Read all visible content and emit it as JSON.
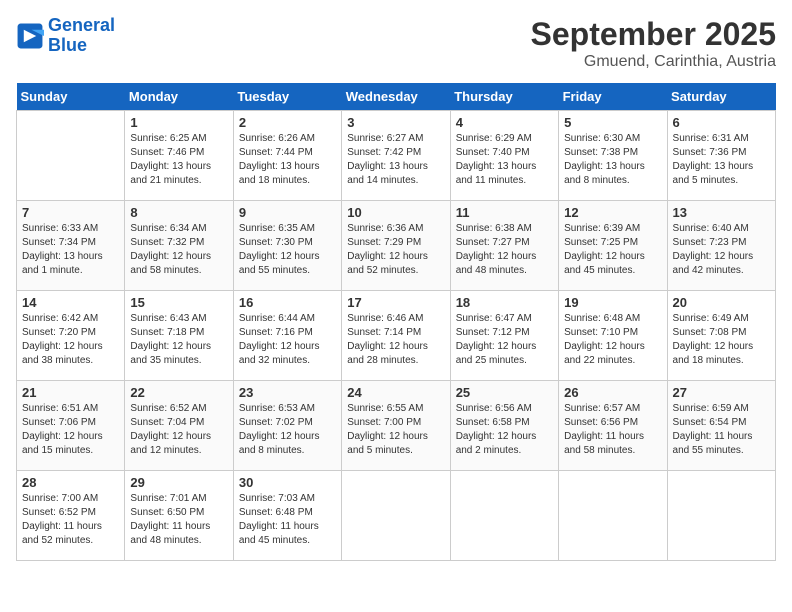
{
  "header": {
    "logo_line1": "General",
    "logo_line2": "Blue",
    "title": "September 2025",
    "subtitle": "Gmuend, Carinthia, Austria"
  },
  "calendar": {
    "days_of_week": [
      "Sunday",
      "Monday",
      "Tuesday",
      "Wednesday",
      "Thursday",
      "Friday",
      "Saturday"
    ],
    "weeks": [
      [
        {
          "date": "",
          "info": ""
        },
        {
          "date": "1",
          "info": "Sunrise: 6:25 AM\nSunset: 7:46 PM\nDaylight: 13 hours\nand 21 minutes."
        },
        {
          "date": "2",
          "info": "Sunrise: 6:26 AM\nSunset: 7:44 PM\nDaylight: 13 hours\nand 18 minutes."
        },
        {
          "date": "3",
          "info": "Sunrise: 6:27 AM\nSunset: 7:42 PM\nDaylight: 13 hours\nand 14 minutes."
        },
        {
          "date": "4",
          "info": "Sunrise: 6:29 AM\nSunset: 7:40 PM\nDaylight: 13 hours\nand 11 minutes."
        },
        {
          "date": "5",
          "info": "Sunrise: 6:30 AM\nSunset: 7:38 PM\nDaylight: 13 hours\nand 8 minutes."
        },
        {
          "date": "6",
          "info": "Sunrise: 6:31 AM\nSunset: 7:36 PM\nDaylight: 13 hours\nand 5 minutes."
        }
      ],
      [
        {
          "date": "7",
          "info": "Sunrise: 6:33 AM\nSunset: 7:34 PM\nDaylight: 13 hours\nand 1 minute."
        },
        {
          "date": "8",
          "info": "Sunrise: 6:34 AM\nSunset: 7:32 PM\nDaylight: 12 hours\nand 58 minutes."
        },
        {
          "date": "9",
          "info": "Sunrise: 6:35 AM\nSunset: 7:30 PM\nDaylight: 12 hours\nand 55 minutes."
        },
        {
          "date": "10",
          "info": "Sunrise: 6:36 AM\nSunset: 7:29 PM\nDaylight: 12 hours\nand 52 minutes."
        },
        {
          "date": "11",
          "info": "Sunrise: 6:38 AM\nSunset: 7:27 PM\nDaylight: 12 hours\nand 48 minutes."
        },
        {
          "date": "12",
          "info": "Sunrise: 6:39 AM\nSunset: 7:25 PM\nDaylight: 12 hours\nand 45 minutes."
        },
        {
          "date": "13",
          "info": "Sunrise: 6:40 AM\nSunset: 7:23 PM\nDaylight: 12 hours\nand 42 minutes."
        }
      ],
      [
        {
          "date": "14",
          "info": "Sunrise: 6:42 AM\nSunset: 7:20 PM\nDaylight: 12 hours\nand 38 minutes."
        },
        {
          "date": "15",
          "info": "Sunrise: 6:43 AM\nSunset: 7:18 PM\nDaylight: 12 hours\nand 35 minutes."
        },
        {
          "date": "16",
          "info": "Sunrise: 6:44 AM\nSunset: 7:16 PM\nDaylight: 12 hours\nand 32 minutes."
        },
        {
          "date": "17",
          "info": "Sunrise: 6:46 AM\nSunset: 7:14 PM\nDaylight: 12 hours\nand 28 minutes."
        },
        {
          "date": "18",
          "info": "Sunrise: 6:47 AM\nSunset: 7:12 PM\nDaylight: 12 hours\nand 25 minutes."
        },
        {
          "date": "19",
          "info": "Sunrise: 6:48 AM\nSunset: 7:10 PM\nDaylight: 12 hours\nand 22 minutes."
        },
        {
          "date": "20",
          "info": "Sunrise: 6:49 AM\nSunset: 7:08 PM\nDaylight: 12 hours\nand 18 minutes."
        }
      ],
      [
        {
          "date": "21",
          "info": "Sunrise: 6:51 AM\nSunset: 7:06 PM\nDaylight: 12 hours\nand 15 minutes."
        },
        {
          "date": "22",
          "info": "Sunrise: 6:52 AM\nSunset: 7:04 PM\nDaylight: 12 hours\nand 12 minutes."
        },
        {
          "date": "23",
          "info": "Sunrise: 6:53 AM\nSunset: 7:02 PM\nDaylight: 12 hours\nand 8 minutes."
        },
        {
          "date": "24",
          "info": "Sunrise: 6:55 AM\nSunset: 7:00 PM\nDaylight: 12 hours\nand 5 minutes."
        },
        {
          "date": "25",
          "info": "Sunrise: 6:56 AM\nSunset: 6:58 PM\nDaylight: 12 hours\nand 2 minutes."
        },
        {
          "date": "26",
          "info": "Sunrise: 6:57 AM\nSunset: 6:56 PM\nDaylight: 11 hours\nand 58 minutes."
        },
        {
          "date": "27",
          "info": "Sunrise: 6:59 AM\nSunset: 6:54 PM\nDaylight: 11 hours\nand 55 minutes."
        }
      ],
      [
        {
          "date": "28",
          "info": "Sunrise: 7:00 AM\nSunset: 6:52 PM\nDaylight: 11 hours\nand 52 minutes."
        },
        {
          "date": "29",
          "info": "Sunrise: 7:01 AM\nSunset: 6:50 PM\nDaylight: 11 hours\nand 48 minutes."
        },
        {
          "date": "30",
          "info": "Sunrise: 7:03 AM\nSunset: 6:48 PM\nDaylight: 11 hours\nand 45 minutes."
        },
        {
          "date": "",
          "info": ""
        },
        {
          "date": "",
          "info": ""
        },
        {
          "date": "",
          "info": ""
        },
        {
          "date": "",
          "info": ""
        }
      ]
    ]
  }
}
